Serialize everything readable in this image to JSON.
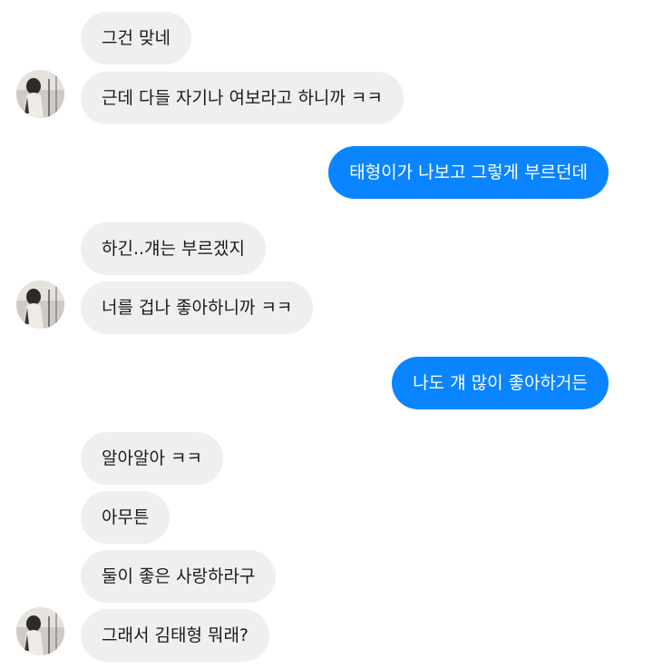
{
  "chat": {
    "messages": [
      {
        "sender": "other",
        "text": "그건 맞네"
      },
      {
        "sender": "other",
        "text": "근데 다들 자기나 여보라고 하니까 ㅋㅋ"
      },
      {
        "sender": "me",
        "text": "태형이가 나보고 그렇게 부르던데"
      },
      {
        "sender": "other",
        "text": "하긴..걔는 부르겠지"
      },
      {
        "sender": "other",
        "text": "너를 겁나 좋아하니까 ㅋㅋ"
      },
      {
        "sender": "me",
        "text": "나도 걔 많이 좋아하거든"
      },
      {
        "sender": "other",
        "text": "알아알아 ㅋㅋ"
      },
      {
        "sender": "other",
        "text": "아무튼"
      },
      {
        "sender": "other",
        "text": "둘이 좋은 사랑하라구"
      },
      {
        "sender": "other",
        "text": "그래서 김태형 뭐래?"
      }
    ]
  },
  "colors": {
    "incoming_bubble": "#efeff1",
    "outgoing_bubble": "#0a84ff",
    "background": "#ffffff"
  },
  "icons": {
    "avatar": "contact-photo"
  }
}
